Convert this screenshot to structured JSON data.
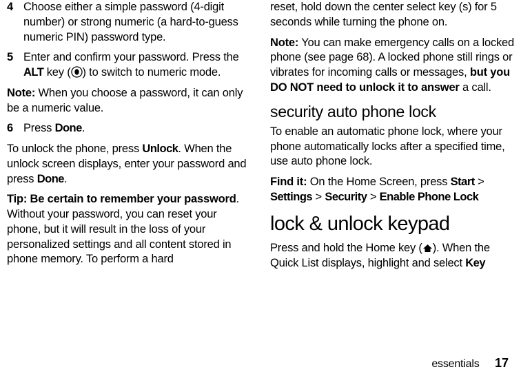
{
  "left": {
    "step4": {
      "num": "4",
      "text": "Choose either a simple password (4-digit number) or strong numeric (a hard-to-guess numeric PIN) password type."
    },
    "step5": {
      "num": "5",
      "pre": "Enter and confirm your password. Press the ",
      "alt": "ALT",
      "mid": " key (",
      "post": ") to switch to numeric mode."
    },
    "note1_label": "Note:",
    "note1_text": " When you choose a password, it can only be a numeric value.",
    "step6": {
      "num": "6",
      "pre": "Press ",
      "done": "Done",
      "post": "."
    },
    "unlock_p1a": "To unlock the phone, press ",
    "unlock_unlock": "Unlock",
    "unlock_p1b": ". When the unlock screen displays, enter your password and press ",
    "unlock_done": "Done",
    "unlock_p1c": ".",
    "tip_label": "Tip: Be certain to remember your password",
    "tip_text": ". Without your password, you can reset your phone, but it will result in the loss of your personalized settings and all content stored in phone memory. To perform a hard"
  },
  "right": {
    "cont": "reset, hold down the center select key (s) for 5 seconds while turning the phone on.",
    "note2_label": "Note:",
    "note2_a": " You can make emergency calls on a locked phone (see page 68). A locked phone still rings or vibrates for incoming calls or messages, ",
    "note2_bold": "but you DO NOT need to unlock it to answer",
    "note2_b": " a call.",
    "h2": "security auto phone lock",
    "auto_p": "To enable an automatic phone lock, where your phone automatically locks after a specified time, use auto phone lock.",
    "findit_label": "Find it:",
    "findit_a": " On the Home Screen, press ",
    "findit_start": "Start",
    "findit_gt1": " > ",
    "findit_settings": "Settings",
    "findit_gt2": " > ",
    "findit_security": "Security",
    "findit_gt3": " > ",
    "findit_enable": "Enable Phone Lock",
    "h1": "lock & unlock keypad",
    "keypad_a": "Press and hold the Home key (",
    "keypad_b": "). When the Quick List displays, highlight and select ",
    "keypad_key": "Key"
  },
  "footer": {
    "section": "essentials",
    "page": "17"
  }
}
